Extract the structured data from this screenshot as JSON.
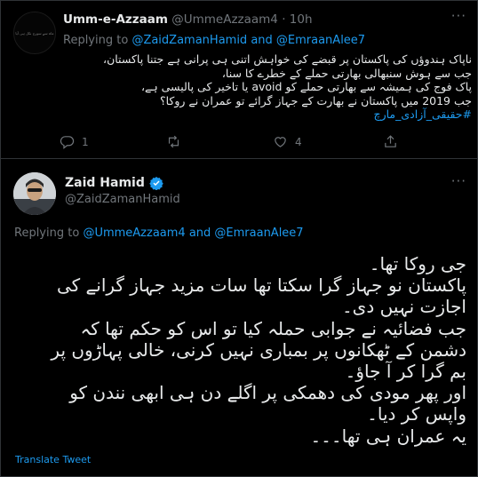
{
  "reply_tweet": {
    "avatar_text": "ماہ سے سورج نکل ہی آیا",
    "author_name": "Umm-e-Azzaam",
    "author_handle": "@UmmeAzzaam4",
    "separator": "·",
    "timestamp": "10h",
    "more_label": "···",
    "replying_prefix": "Replying to",
    "replying_to": "@ZaidZamanHamid and @EmraanAlee7",
    "lines": [
      "ناپاک ہندوؤں کی پاکستان پر قبضے کی خواہش اتنی ہی پرانی ہے جتنا پاکستان،",
      "جب سے ہوش سنبھالی بھارتی حملے کے خطرے کا سنا،",
      "پاک فوج کی ہمیشہ سے بھارتی حملے کو avoid یا تاخیر کی پالیسی ہے،",
      "جب 2019 میں پاکستان نے بھارت کے جہاز گرائے تو عمران نے روکا؟"
    ],
    "hashtag": "#حقیقی_آزادی_مارچ",
    "actions": {
      "reply_count": "1",
      "retweet_count": "",
      "like_count": "4"
    }
  },
  "main_tweet": {
    "author_name": "Zaid Hamid",
    "author_handle": "@ZaidZamanHamid",
    "more_label": "···",
    "replying_prefix": "Replying to",
    "replying_to": "@UmmeAzzaam4 and @EmraanAlee7",
    "lines": [
      "جی روکا تھا۔",
      "پاکستان نو جہاز گرا سکتا تھا سات مزید جہاز گرانے کی",
      "اجازت نہیں دی۔",
      "جب فضائیہ نے جوابی حملہ کیا تو اس کو حکم تھا کہ",
      "دشمن کے ٹھکانوں پر بمباری نہیں کرنی، خالی پہاڑوں پر",
      "بم گرا کر آ جاؤ۔",
      "اور پھر مودی کی دھمکی پر اگلے دن ہی ابھی نندن کو",
      "واپس کر دیا۔",
      "یہ عمران ہی تھا۔۔۔"
    ],
    "translate_label": "Translate Tweet"
  },
  "colors": {
    "background": "#000000",
    "text": "#e7e9ea",
    "secondary": "#71767b",
    "accent": "#1d9bf0",
    "border": "#2f3336"
  }
}
